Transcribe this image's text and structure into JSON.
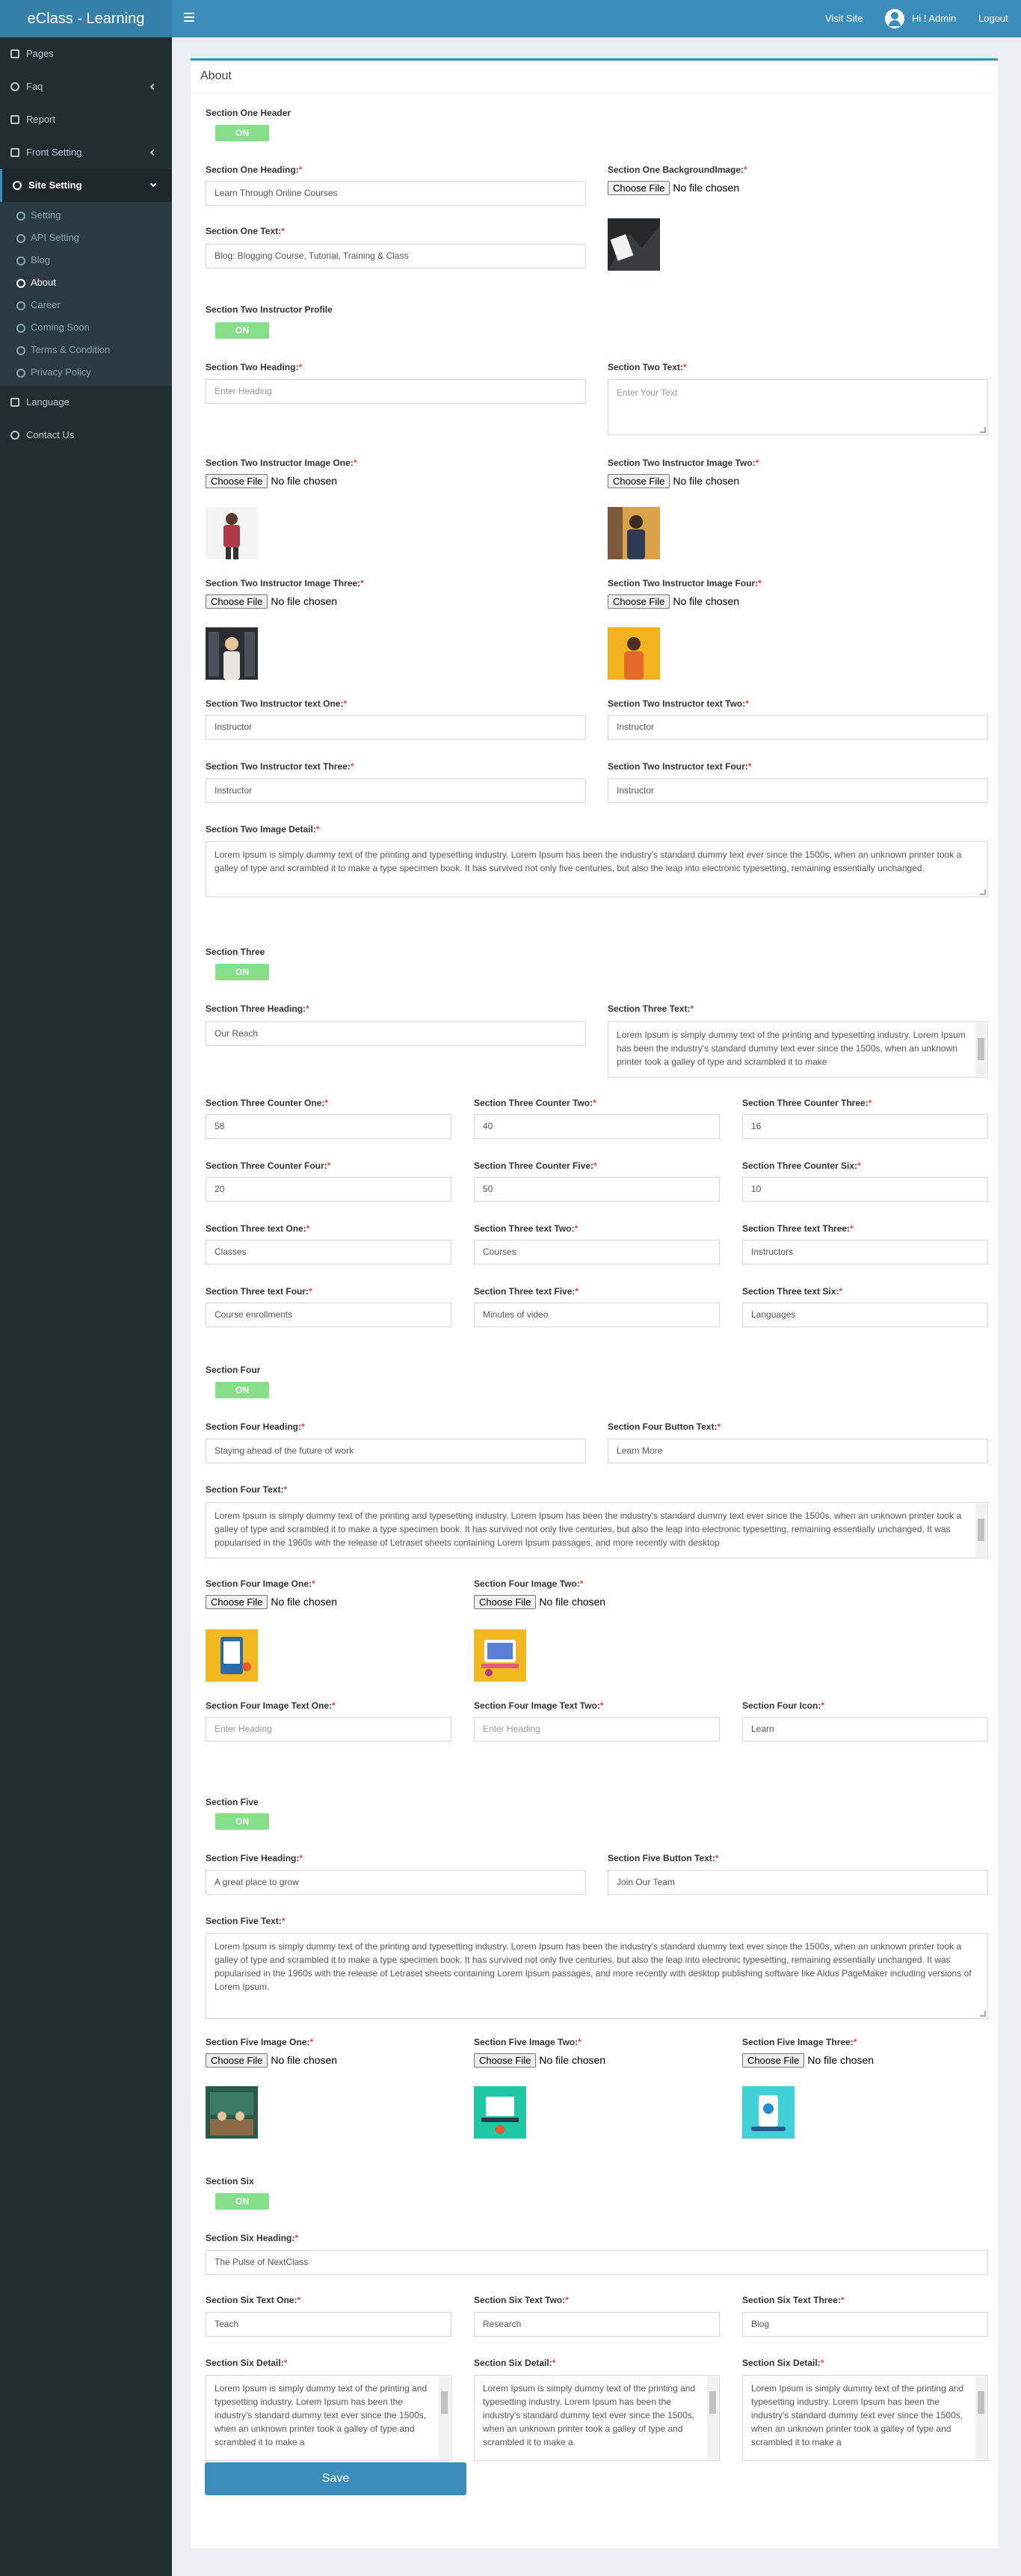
{
  "app": {
    "title": "eClass - Learning"
  },
  "topbar": {
    "visit": "Visit Site",
    "user": "Hi ! Admin",
    "logout": "Logout"
  },
  "sidebar": {
    "pages": "Pages",
    "faq": "Faq",
    "report": "Report",
    "front": "Front Setting",
    "site": "Site Setting",
    "sub": [
      "Setting",
      "API Setting",
      "Blog",
      "About",
      "Career",
      "Coming Soon",
      "Terms & Condition",
      "Privacy Policy"
    ],
    "language": "Language",
    "contact": "Contact Us"
  },
  "page": {
    "title": "About",
    "toggle": "ON",
    "file_button": "Choose File",
    "file_none": "No file chosen",
    "save": "Save"
  },
  "s1": {
    "header": "Section One Header",
    "heading_label": "Section One Heading:",
    "heading": "Learn Through Online Courses",
    "bg_label": "Section One BackgroundImage:",
    "text_label": "Section One Text:",
    "text": "Blog: Blogging Course, Tutorial, Training & Class"
  },
  "s2": {
    "header": "Section Two Instructor Profile",
    "heading_label": "Section Two Heading:",
    "heading_ph": "Enter Heading",
    "text_label": "Section Two Text:",
    "text_ph": "Enter Your Text",
    "img1": "Section Two Instructor Image One:",
    "img2": "Section Two Instructor Image Two:",
    "img3": "Section Two Instructor Image Three:",
    "img4": "Section Two Instructor Image Four:",
    "t1_label": "Section Two Instructor text One:",
    "t2_label": "Section Two Instructor text Two:",
    "t3_label": "Section Two Instructor text Three:",
    "t4_label": "Section Two Instructor text Four:",
    "instructor": "Instructor",
    "detail_label": "Section Two Image Detail:",
    "detail": "Lorem Ipsum is simply dummy text of the printing and typesetting industry. Lorem Ipsum has been the industry's standard dummy text ever since the 1500s, when an unknown printer took a galley of type and scrambled it to make a type specimen book. It has survived not only five centuries, but also the leap into electronic typesetting, remaining essentially unchanged."
  },
  "s3": {
    "header": "Section Three",
    "heading_label": "Section Three Heading:",
    "heading": "Our Reach",
    "text_label": "Section Three Text:",
    "text": "Lorem Ipsum is simply dummy text of the printing and typesetting industry. Lorem Ipsum has been the industry's standard dummy text ever since the 1500s, when an unknown printer took a galley of type and scrambled it to make",
    "c1_label": "Section Three Counter One:",
    "c1": "58",
    "c2_label": "Section Three Counter Two:",
    "c2": "40",
    "c3_label": "Section Three Counter Three:",
    "c3": "16",
    "c4_label": "Section Three Counter Four:",
    "c4": "20",
    "c5_label": "Section Three Counter Five:",
    "c5": "50",
    "c6_label": "Section Three Counter Six:",
    "c6": "10",
    "t1_label": "Section Three text One:",
    "t1": "Classes",
    "t2_label": "Section Three text Two:",
    "t2": "Courses",
    "t3_label": "Section Three text Three:",
    "t3": "Instructors",
    "t4_label": "Section Three text Four:",
    "t4": "Course enrollments",
    "t5_label": "Section Three text Five:",
    "t5": "Minutes of video",
    "t6_label": "Section Three text Six:",
    "t6": "Languages"
  },
  "s4": {
    "header": "Section Four",
    "heading_label": "Section Four Heading:",
    "heading": "Staying ahead of the future of work",
    "btn_label": "Section Four Button Text:",
    "btn": "Learn More",
    "text_label": "Section Four Text:",
    "text": "Lorem Ipsum is simply dummy text of the printing and typesetting industry. Lorem Ipsum has been the industry's standard dummy text ever since the 1500s, when an unknown printer took a galley of type and scrambled it to make a type specimen book. It has survived not only five centuries, but also the leap into electronic typesetting, remaining essentially unchanged. It was popularised in the 1960s with the release of Letraset sheets containing Lorem Ipsum passages, and more recently with desktop",
    "img1": "Section Four Image One:",
    "img2": "Section Four Image Two:",
    "it1_label": "Section Four Image Text One:",
    "it2_label": "Section Four Image Text Two:",
    "heading_ph": "Enter Heading",
    "icon_label": "Section Four Icon:",
    "icon": "Learn"
  },
  "s5": {
    "header": "Section Five",
    "heading_label": "Section Five Heading:",
    "heading": "A great place to grow",
    "btn_label": "Section Five Button Text:",
    "btn": "Join Our Team",
    "text_label": "Section Five Text:",
    "text": "Lorem Ipsum is simply dummy text of the printing and typesetting industry. Lorem Ipsum has been the industry's standard dummy text ever since the 1500s, when an unknown printer took a galley of type and scrambled it to make a type specimen book. It has survived not only five centuries, but also the leap into electronic typesetting, remaining essentially unchanged. It was popularised in the 1960s with the release of Letraset sheets containing Lorem Ipsum passages, and more recently with desktop publishing software like Aldus PageMaker including versions of Lorem Ipsum.",
    "img1": "Section Five Image One:",
    "img2": "Section Five Image Two:",
    "img3": "Section Five Image Three:"
  },
  "s6": {
    "header": "Section Six",
    "heading_label": "Section Six Heading:",
    "heading": "The Pulse of NextClass",
    "t1_label": "Section Six Text One:",
    "t1": "Teach",
    "t2_label": "Section Six Text Two:",
    "t2": "Research",
    "t3_label": "Section Six Text Three:",
    "t3": "Blog",
    "detail_label": "Section Six Detail:",
    "detail": "Lorem Ipsum is simply dummy text of the printing and typesetting industry. Lorem Ipsum has been the industry's standard dummy text ever since the 1500s, when an unknown printer took a galley of type and scrambled it to make a"
  }
}
